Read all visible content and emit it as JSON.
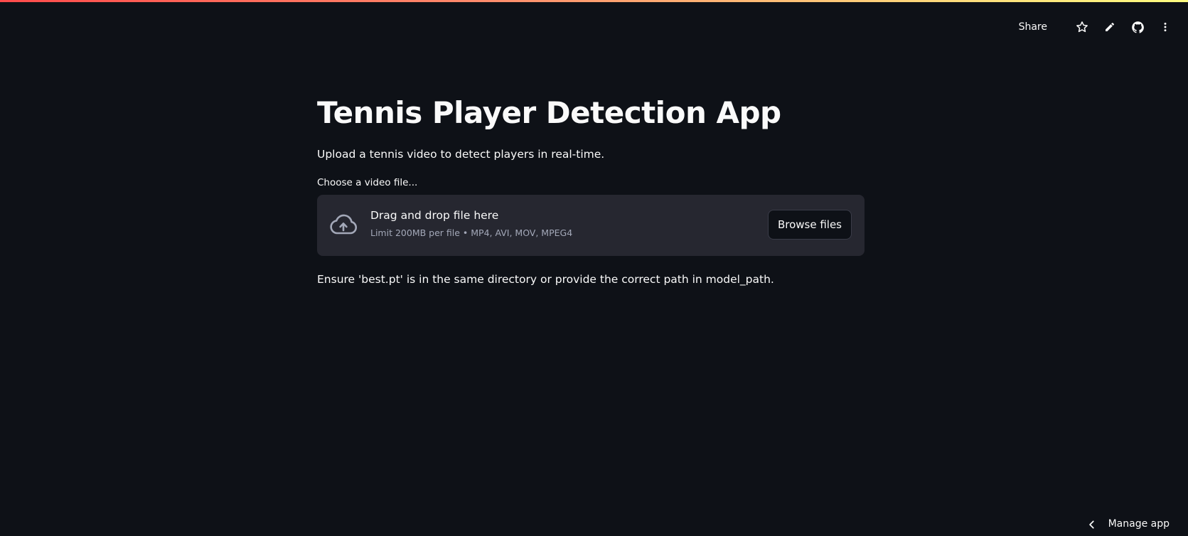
{
  "header": {
    "share_label": "Share",
    "icons": [
      "star-icon",
      "pencil-icon",
      "github-icon",
      "kebab-menu-icon"
    ]
  },
  "main": {
    "title": "Tennis Player Detection App",
    "subtitle": "Upload a tennis video to detect players in real-time.",
    "uploader": {
      "label": "Choose a video file...",
      "drop_text": "Drag and drop file here",
      "limit_text": "Limit 200MB per file • MP4, AVI, MOV, MPEG4",
      "browse_label": "Browse files",
      "icon": "cloud-upload-icon"
    },
    "note": "Ensure 'best.pt' is in the same directory or provide the correct path in model_path."
  },
  "footer": {
    "manage_label": "Manage app",
    "icon": "chevron-left-icon"
  },
  "colors": {
    "background": "#0e1117",
    "dropzone": "#262730",
    "text": "#fafafa",
    "muted_text": "#a3a8b8",
    "accent_gradient_start": "#ff4b4b",
    "accent_gradient_end": "#fffd80"
  }
}
